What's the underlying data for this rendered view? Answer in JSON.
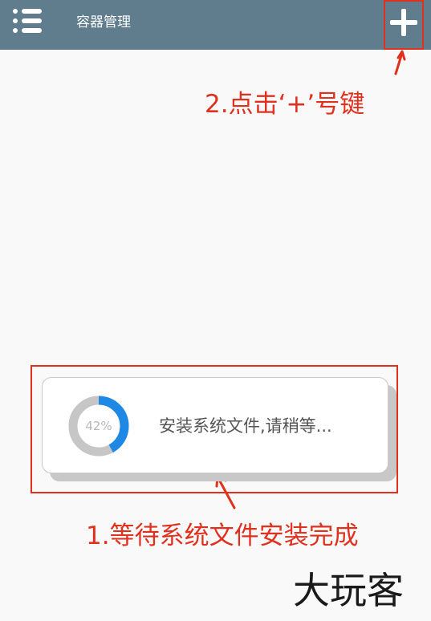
{
  "toolbar": {
    "title": "容器管理",
    "menu_icon": "list-menu-icon",
    "add_icon": "plus-icon",
    "background": "#5f7d8c"
  },
  "progress": {
    "fraction": 0.42,
    "percent_label": "42%",
    "message": "安装系统文件,请稍等...",
    "ring_color": "#1e88e5",
    "track_color": "#c6c6c6"
  },
  "annotations": {
    "step_2": "2.点击‘+’号键",
    "step_1": "1.等待系统文件安装完成",
    "color": "#e0301e"
  },
  "watermark": "大玩客"
}
